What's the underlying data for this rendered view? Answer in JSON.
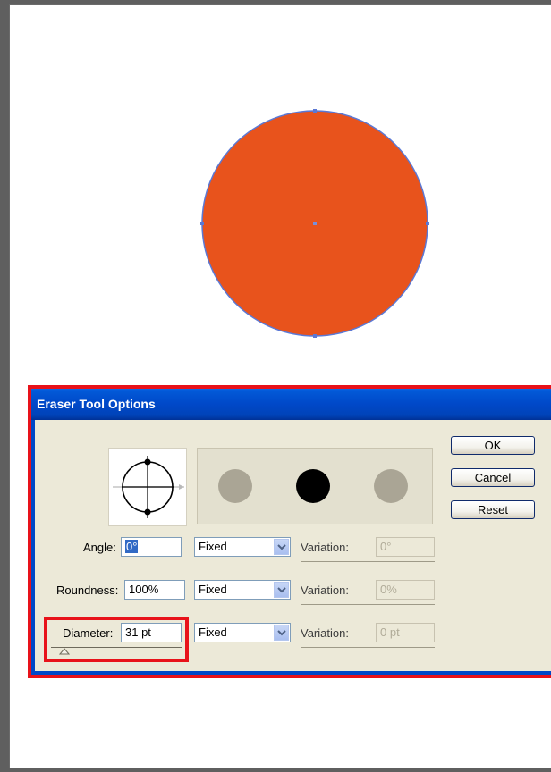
{
  "colors": {
    "circle_fill": "#e8531c",
    "selection": "#5b78d4",
    "highlight": "#e8121a",
    "dialog_bg": "#ece9d8",
    "titlebar": "#0048c8"
  },
  "dialog": {
    "title": "Eraser Tool Options",
    "buttons": {
      "ok": "OK",
      "cancel": "Cancel",
      "reset": "Reset"
    },
    "rows": [
      {
        "label": "Angle:",
        "value": "0°",
        "mode": "Fixed",
        "variation_label": "Variation:",
        "variation_value": "0°"
      },
      {
        "label": "Roundness:",
        "value": "100%",
        "mode": "Fixed",
        "variation_label": "Variation:",
        "variation_value": "0%"
      },
      {
        "label": "Diameter:",
        "value": "31 pt",
        "mode": "Fixed",
        "variation_label": "Variation:",
        "variation_value": "0 pt"
      }
    ],
    "angle_selected_text": "0°",
    "diameter_slider": {
      "level": 0.1
    }
  }
}
